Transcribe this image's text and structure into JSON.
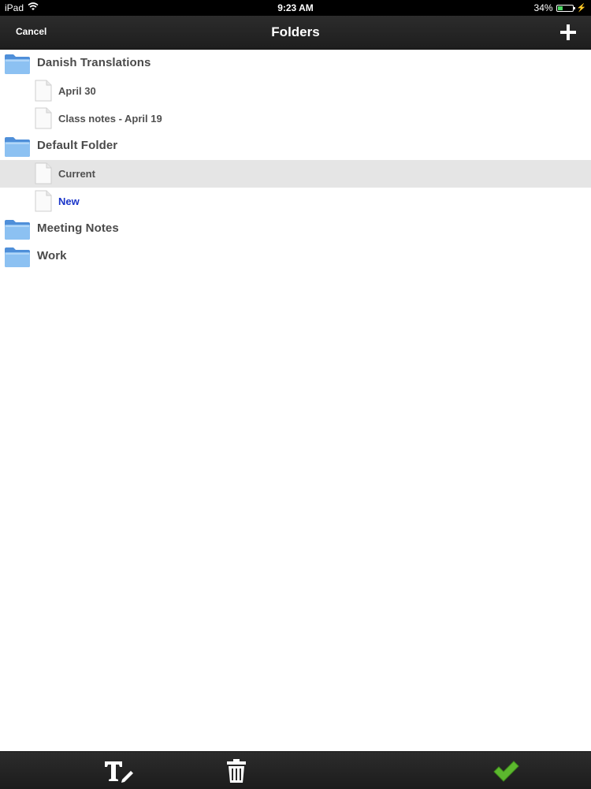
{
  "status_bar": {
    "device": "iPad",
    "time": "9:23 AM",
    "battery_percent": "34%",
    "battery_level": 0.34,
    "wifi_icon": "wifi-icon",
    "charging_icon": "charging-bolt-icon"
  },
  "nav": {
    "cancel_label": "Cancel",
    "title": "Folders",
    "add_icon": "plus-icon"
  },
  "tree": [
    {
      "kind": "folder",
      "label": "Danish Translations"
    },
    {
      "kind": "file",
      "label": "April 30"
    },
    {
      "kind": "file",
      "label": "Class notes - April 19"
    },
    {
      "kind": "folder",
      "label": "Default Folder"
    },
    {
      "kind": "file",
      "label": "Current",
      "selected": true
    },
    {
      "kind": "file",
      "label": "New",
      "highlight": true
    },
    {
      "kind": "folder",
      "label": "Meeting Notes"
    },
    {
      "kind": "folder",
      "label": "Work"
    }
  ],
  "toolbar": {
    "rename_icon": "rename-text-icon",
    "delete_icon": "trash-icon",
    "confirm_icon": "checkmark-icon"
  },
  "colors": {
    "bar_background": "#1e1e1e",
    "selected_row": "#e5e5e5",
    "new_item_text": "#1a35c9",
    "folder_blue": "#6aa7e8",
    "confirm_green": "#5cb82e"
  }
}
